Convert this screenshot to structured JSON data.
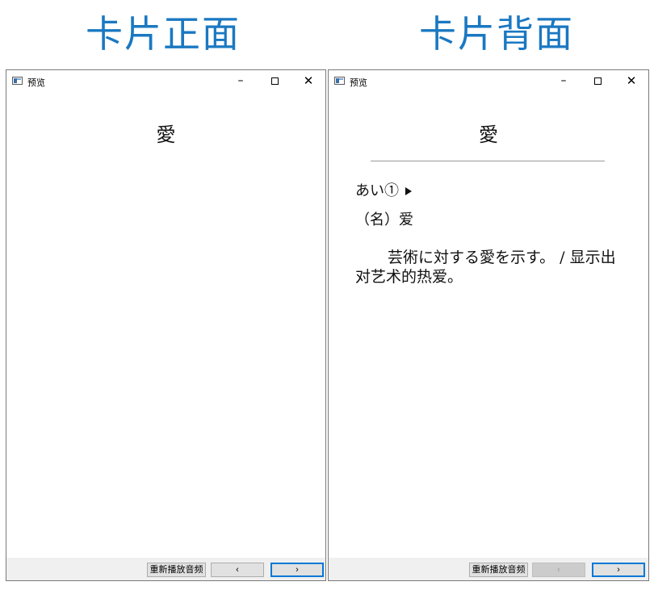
{
  "headings": {
    "front": "卡片正面",
    "back": "卡片背面"
  },
  "window": {
    "title": "预览",
    "icon": "app-window-icon",
    "controls": {
      "minimize": "–",
      "close": "✕"
    }
  },
  "front_card": {
    "word": "愛",
    "buttons": {
      "replay": "重新播放音频",
      "prev": "‹",
      "next": "›"
    }
  },
  "back_card": {
    "word": "愛",
    "reading": "あい①",
    "part_of_speech": "（名）爱",
    "example": "芸術に対する愛を示す。 / 显示出对艺术的热爱。",
    "buttons": {
      "replay": "重新播放音频",
      "prev": "‹",
      "next": "›"
    },
    "prev_disabled": true
  },
  "colors": {
    "heading": "#1a78c2",
    "focus_border": "#0078d7",
    "bar": "#f0f0f0"
  }
}
